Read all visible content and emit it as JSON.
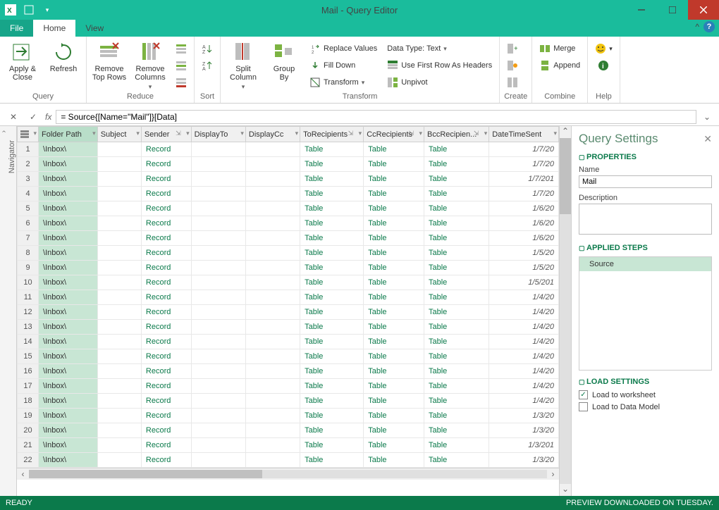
{
  "window": {
    "title": "Mail - Query Editor"
  },
  "tabs": {
    "file": "File",
    "home": "Home",
    "view": "View"
  },
  "ribbon": {
    "query": {
      "label": "Query",
      "apply_close": "Apply &\nClose",
      "refresh": "Refresh"
    },
    "reduce": {
      "label": "Reduce",
      "remove_top": "Remove\nTop Rows",
      "remove_cols": "Remove\nColumns"
    },
    "sort": {
      "label": "Sort"
    },
    "transform": {
      "label": "Transform",
      "split": "Split\nColumn",
      "group": "Group\nBy",
      "replace": "Replace Values",
      "fill": "Fill Down",
      "transformbtn": "Transform",
      "datatype": "Data Type: Text",
      "first_row": "Use First Row As Headers",
      "unpivot": "Unpivot"
    },
    "create": {
      "label": "Create"
    },
    "combine": {
      "label": "Combine",
      "merge": "Merge",
      "append": "Append"
    },
    "help": {
      "label": "Help"
    }
  },
  "formula": {
    "value": "= Source{[Name=\"Mail\"]}[Data]"
  },
  "navigator": "Navigator",
  "columns": [
    "Folder Path",
    "Subject",
    "Sender",
    "DisplayTo",
    "DisplayCc",
    "ToRecipients",
    "CcRecipients",
    "BccRecipien...",
    "DateTimeSent"
  ],
  "rows": [
    {
      "n": 1,
      "folder": "\\Inbox\\",
      "sender": "Record",
      "to": "Table",
      "cc": "Table",
      "bcc": "Table",
      "date": "1/7/20"
    },
    {
      "n": 2,
      "folder": "\\Inbox\\",
      "sender": "Record",
      "to": "Table",
      "cc": "Table",
      "bcc": "Table",
      "date": "1/7/20"
    },
    {
      "n": 3,
      "folder": "\\Inbox\\",
      "sender": "Record",
      "to": "Table",
      "cc": "Table",
      "bcc": "Table",
      "date": "1/7/201"
    },
    {
      "n": 4,
      "folder": "\\Inbox\\",
      "sender": "Record",
      "to": "Table",
      "cc": "Table",
      "bcc": "Table",
      "date": "1/7/20"
    },
    {
      "n": 5,
      "folder": "\\Inbox\\",
      "sender": "Record",
      "to": "Table",
      "cc": "Table",
      "bcc": "Table",
      "date": "1/6/20"
    },
    {
      "n": 6,
      "folder": "\\Inbox\\",
      "sender": "Record",
      "to": "Table",
      "cc": "Table",
      "bcc": "Table",
      "date": "1/6/20"
    },
    {
      "n": 7,
      "folder": "\\Inbox\\",
      "sender": "Record",
      "to": "Table",
      "cc": "Table",
      "bcc": "Table",
      "date": "1/6/20"
    },
    {
      "n": 8,
      "folder": "\\Inbox\\",
      "sender": "Record",
      "to": "Table",
      "cc": "Table",
      "bcc": "Table",
      "date": "1/5/20"
    },
    {
      "n": 9,
      "folder": "\\Inbox\\",
      "sender": "Record",
      "to": "Table",
      "cc": "Table",
      "bcc": "Table",
      "date": "1/5/20"
    },
    {
      "n": 10,
      "folder": "\\Inbox\\",
      "sender": "Record",
      "to": "Table",
      "cc": "Table",
      "bcc": "Table",
      "date": "1/5/201"
    },
    {
      "n": 11,
      "folder": "\\Inbox\\",
      "sender": "Record",
      "to": "Table",
      "cc": "Table",
      "bcc": "Table",
      "date": "1/4/20"
    },
    {
      "n": 12,
      "folder": "\\Inbox\\",
      "sender": "Record",
      "to": "Table",
      "cc": "Table",
      "bcc": "Table",
      "date": "1/4/20"
    },
    {
      "n": 13,
      "folder": "\\Inbox\\",
      "sender": "Record",
      "to": "Table",
      "cc": "Table",
      "bcc": "Table",
      "date": "1/4/20"
    },
    {
      "n": 14,
      "folder": "\\Inbox\\",
      "sender": "Record",
      "to": "Table",
      "cc": "Table",
      "bcc": "Table",
      "date": "1/4/20"
    },
    {
      "n": 15,
      "folder": "\\Inbox\\",
      "sender": "Record",
      "to": "Table",
      "cc": "Table",
      "bcc": "Table",
      "date": "1/4/20"
    },
    {
      "n": 16,
      "folder": "\\Inbox\\",
      "sender": "Record",
      "to": "Table",
      "cc": "Table",
      "bcc": "Table",
      "date": "1/4/20"
    },
    {
      "n": 17,
      "folder": "\\Inbox\\",
      "sender": "Record",
      "to": "Table",
      "cc": "Table",
      "bcc": "Table",
      "date": "1/4/20"
    },
    {
      "n": 18,
      "folder": "\\Inbox\\",
      "sender": "Record",
      "to": "Table",
      "cc": "Table",
      "bcc": "Table",
      "date": "1/4/20"
    },
    {
      "n": 19,
      "folder": "\\Inbox\\",
      "sender": "Record",
      "to": "Table",
      "cc": "Table",
      "bcc": "Table",
      "date": "1/3/20"
    },
    {
      "n": 20,
      "folder": "\\Inbox\\",
      "sender": "Record",
      "to": "Table",
      "cc": "Table",
      "bcc": "Table",
      "date": "1/3/20"
    },
    {
      "n": 21,
      "folder": "\\Inbox\\",
      "sender": "Record",
      "to": "Table",
      "cc": "Table",
      "bcc": "Table",
      "date": "1/3/201"
    },
    {
      "n": 22,
      "folder": "\\Inbox\\",
      "sender": "Record",
      "to": "Table",
      "cc": "Table",
      "bcc": "Table",
      "date": "1/3/20"
    }
  ],
  "settings": {
    "title": "Query Settings",
    "properties": "PROPERTIES",
    "name_label": "Name",
    "name_value": "Mail",
    "desc_label": "Description",
    "applied": "APPLIED STEPS",
    "step1": "Source",
    "load": "LOAD SETTINGS",
    "load_ws": "Load to worksheet",
    "load_dm": "Load to Data Model"
  },
  "status": {
    "left": "READY",
    "right": "PREVIEW DOWNLOADED ON TUESDAY."
  }
}
